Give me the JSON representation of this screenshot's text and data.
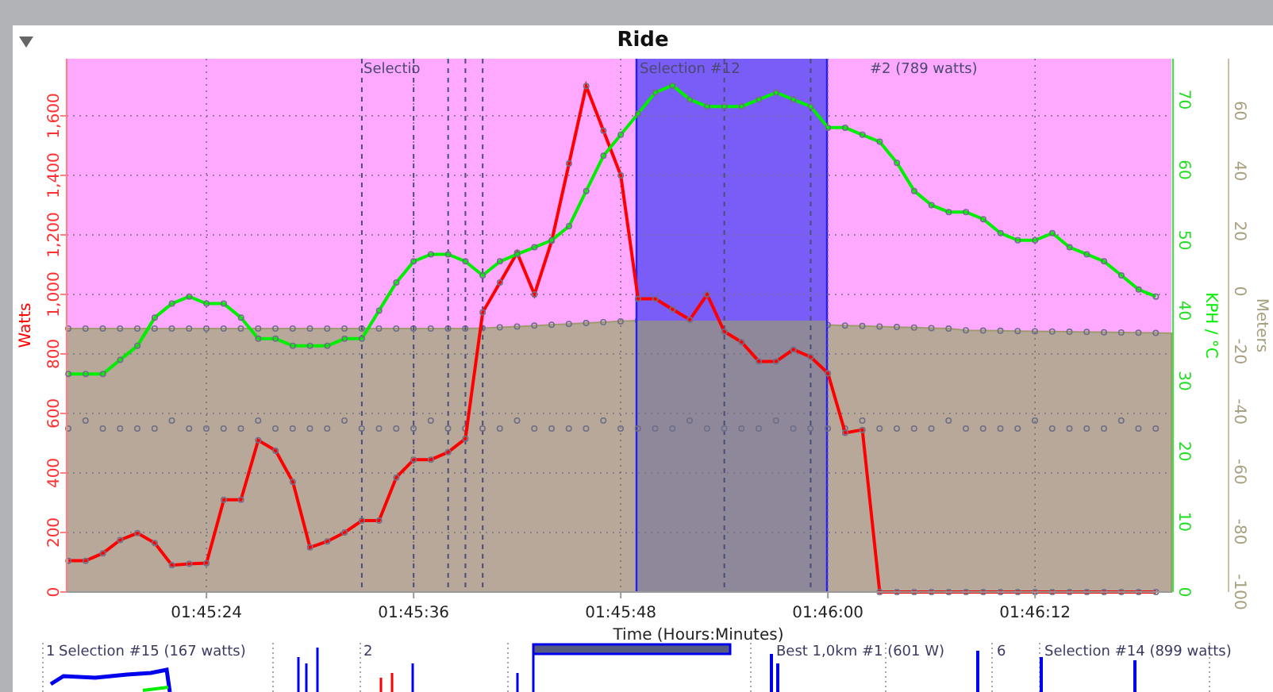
{
  "panel": {
    "title": "Ride"
  },
  "selection_labels": [
    "Selectio",
    "Selection #12",
    "#2 (789 watts)"
  ],
  "chart_data": {
    "type": "line",
    "xlabel": "Time (Hours:Minutes)",
    "grid": true,
    "xlim": [
      6315.9,
      6379.9
    ],
    "ylim": [
      0,
      1792
    ],
    "x": [
      6316,
      6317,
      6318,
      6319,
      6320,
      6321,
      6322,
      6323,
      6324,
      6325,
      6326,
      6327,
      6328,
      6329,
      6330,
      6331,
      6332,
      6333,
      6334,
      6335,
      6336,
      6337,
      6338,
      6339,
      6340,
      6341,
      6342,
      6343,
      6344,
      6345,
      6346,
      6347,
      6348,
      6349,
      6350,
      6351,
      6352,
      6353,
      6354,
      6355,
      6356,
      6357,
      6358,
      6359,
      6360,
      6361,
      6362,
      6363,
      6364,
      6365,
      6366,
      6367,
      6368,
      6369,
      6370,
      6371,
      6372,
      6373,
      6374,
      6375,
      6376,
      6377,
      6378,
      6379
    ],
    "xticks": [
      {
        "value": 6324,
        "label": "01:45:24"
      },
      {
        "value": 6336,
        "label": "01:45:36"
      },
      {
        "value": 6348,
        "label": "01:45:48"
      },
      {
        "value": 6360,
        "label": "01:46:00"
      },
      {
        "value": 6372,
        "label": "01:46:12"
      }
    ],
    "yticks": [
      0,
      200,
      400,
      600,
      800,
      {
        "value": 1000,
        "label": "1,000"
      },
      {
        "value": 1200,
        "label": "1,200"
      },
      {
        "value": 1400,
        "label": "1,400"
      },
      {
        "value": 1600,
        "label": "1,600"
      }
    ],
    "ref_lines": [
      {
        "value": 6333,
        "axis": "x"
      },
      {
        "value": 6336,
        "axis": "x"
      },
      {
        "value": 6338,
        "axis": "x"
      },
      {
        "value": 6339,
        "axis": "x"
      },
      {
        "value": 6340,
        "axis": "x"
      },
      {
        "value": 6354,
        "axis": "x"
      },
      {
        "value": 6359,
        "axis": "x"
      }
    ],
    "series": [
      {
        "name": "Watts",
        "color": "#ff0000",
        "marker": "o",
        "values": [
          105,
          105,
          130,
          175,
          198,
          165,
          90,
          95,
          97,
          310,
          310,
          510,
          475,
          370,
          150,
          170,
          200,
          240,
          240,
          385,
          445,
          445,
          470,
          515,
          940,
          1040,
          1140,
          1000,
          1180,
          1440,
          1700,
          1550,
          1400,
          985,
          985,
          950,
          915,
          1000,
          875,
          840,
          775,
          775,
          815,
          790,
          735,
          535,
          545,
          0,
          0,
          0,
          0,
          0,
          0,
          0,
          0,
          0,
          0,
          0,
          0,
          0,
          0,
          0,
          0,
          0
        ]
      }
    ]
  },
  "speed_chart": {
    "chart_data": {
      "type": "line",
      "xlim": [
        6315.9,
        6379.9
      ],
      "ylim": [
        0,
        75.8
      ],
      "x": [
        6316,
        6317,
        6318,
        6319,
        6320,
        6321,
        6322,
        6323,
        6324,
        6325,
        6326,
        6327,
        6328,
        6329,
        6330,
        6331,
        6332,
        6333,
        6334,
        6335,
        6336,
        6337,
        6338,
        6339,
        6340,
        6341,
        6342,
        6343,
        6344,
        6345,
        6346,
        6347,
        6348,
        6349,
        6350,
        6351,
        6352,
        6353,
        6354,
        6355,
        6356,
        6357,
        6358,
        6359,
        6360,
        6361,
        6362,
        6363,
        6364,
        6365,
        6366,
        6367,
        6368,
        6369,
        6370,
        6371,
        6372,
        6373,
        6374,
        6375,
        6376,
        6377,
        6378,
        6379
      ],
      "yticks": [
        0,
        10,
        20,
        30,
        40,
        50,
        60,
        70
      ],
      "series": [
        {
          "name": "KPH / °C",
          "color": "#00ee00",
          "marker": "o",
          "values": [
            31,
            31,
            31,
            33,
            35,
            39,
            41,
            42,
            41,
            41,
            39,
            36,
            36,
            35,
            35,
            35,
            36,
            36,
            40,
            44,
            47,
            48,
            48,
            47,
            45,
            47,
            48,
            49,
            50,
            52,
            57,
            62,
            65,
            68,
            71,
            72,
            70,
            69,
            69,
            69,
            70,
            71,
            70,
            69,
            66,
            66,
            65,
            64,
            61,
            57,
            55,
            54,
            54,
            53,
            51,
            50,
            50,
            51,
            49,
            48,
            47,
            45,
            43,
            42
          ]
        }
      ]
    }
  },
  "altitude_axis": {
    "title": "Meters",
    "ticks": [
      "-100",
      "-80",
      "-60",
      "-40",
      "-20",
      "0",
      "20",
      "40",
      "60"
    ]
  },
  "mini_labels": [
    "1",
    "Selection #15 (167 watts)",
    "2",
    "Best 1,0km #1 (601 W)",
    "6",
    "Selection #14 (899 watts)"
  ]
}
